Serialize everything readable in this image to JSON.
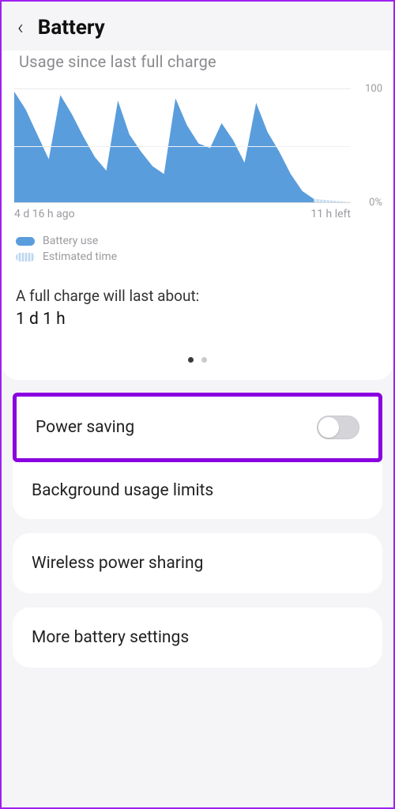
{
  "header": {
    "title": "Battery"
  },
  "usage": {
    "title": "Usage since last full charge",
    "xaxis_start": "4 d 16 h ago",
    "xaxis_end": "11 h left",
    "ymax_label": "100",
    "ymin_label": "0%",
    "legend_use": "Battery use",
    "legend_est": "Estimated time",
    "estimate_label": "A full charge will last about:",
    "estimate_value": "1 d 1 h"
  },
  "options": {
    "power_saving": "Power saving",
    "bg_limits": "Background usage limits",
    "wireless_share": "Wireless power sharing",
    "more_settings": "More battery settings"
  },
  "chart_data": {
    "type": "area",
    "ylim": [
      0,
      100
    ],
    "xlabel": "",
    "ylabel": "%",
    "title": "Usage since last full charge",
    "series": [
      {
        "name": "Battery use",
        "values": [
          98,
          82,
          60,
          38,
          95,
          78,
          58,
          40,
          28,
          90,
          60,
          45,
          32,
          25,
          92,
          68,
          52,
          48,
          70,
          55,
          35,
          88,
          62,
          45,
          25,
          10,
          3
        ]
      },
      {
        "name": "Estimated time",
        "values": [
          3,
          0
        ]
      }
    ],
    "x_start_label": "4 d 16 h ago",
    "x_end_label": "11 h left"
  }
}
